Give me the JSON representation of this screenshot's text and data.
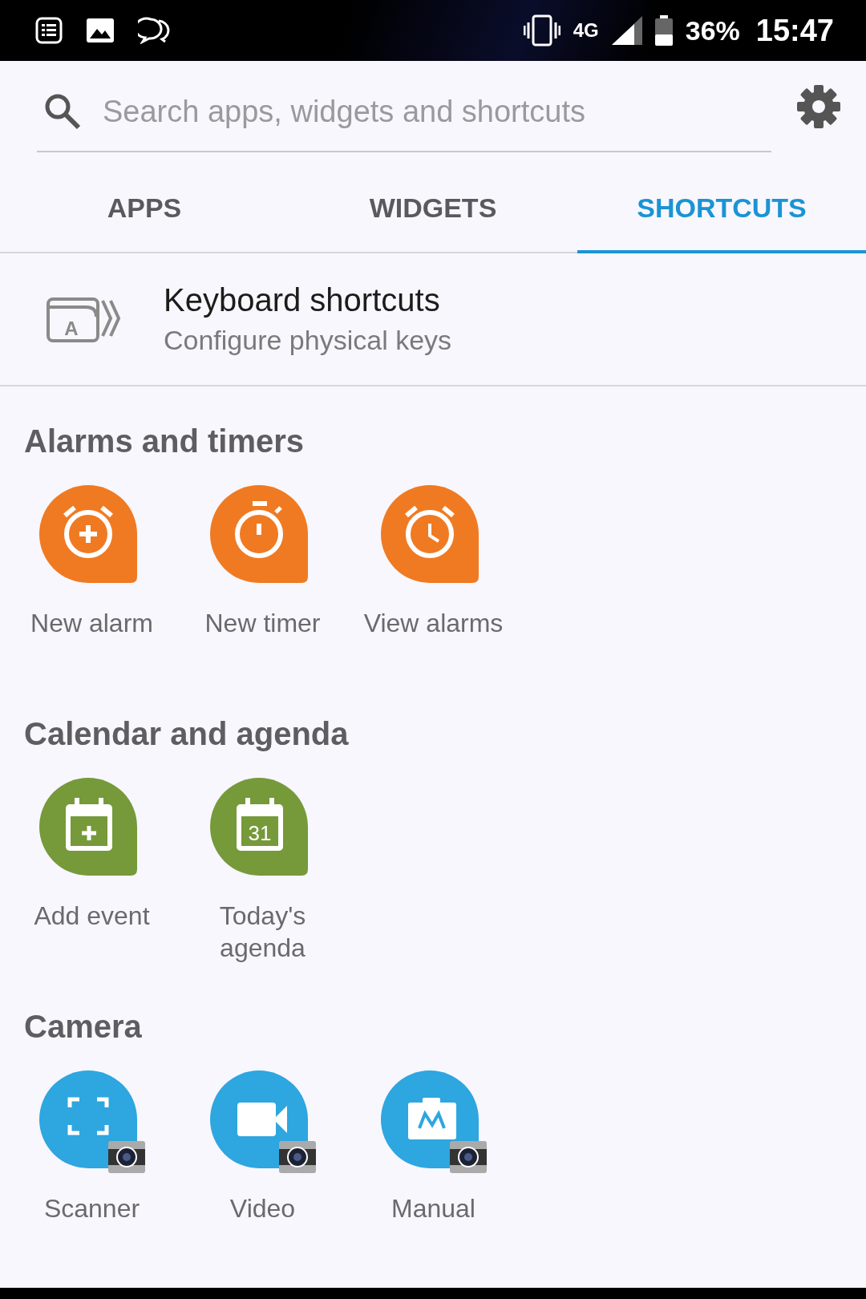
{
  "status_bar": {
    "network": "4G",
    "battery": "36%",
    "time": "15:47"
  },
  "search": {
    "placeholder": "Search apps, widgets and shortcuts"
  },
  "tabs": [
    {
      "label": "APPS",
      "selected": false
    },
    {
      "label": "WIDGETS",
      "selected": false
    },
    {
      "label": "SHORTCUTS",
      "selected": true
    }
  ],
  "keyboard_item": {
    "icon_letter": "A",
    "title": "Keyboard shortcuts",
    "subtitle": "Configure physical keys"
  },
  "sections": [
    {
      "title": "Alarms and timers",
      "color": "#f07a22",
      "items": [
        {
          "label": "New alarm",
          "kind": "alarm_add"
        },
        {
          "label": "New timer",
          "kind": "timer"
        },
        {
          "label": "View alarms",
          "kind": "alarm"
        }
      ]
    },
    {
      "title": "Calendar and agenda",
      "color": "#76993a",
      "items": [
        {
          "label": "Add event",
          "kind": "event_add"
        },
        {
          "label": "Today's agenda",
          "kind": "agenda",
          "icon_text": "31"
        }
      ]
    },
    {
      "title": "Camera",
      "color": "#2ea6df",
      "items": [
        {
          "label": "Scanner",
          "kind": "scanner"
        },
        {
          "label": "Video",
          "kind": "video"
        },
        {
          "label": "Manual",
          "kind": "manual"
        }
      ]
    }
  ]
}
